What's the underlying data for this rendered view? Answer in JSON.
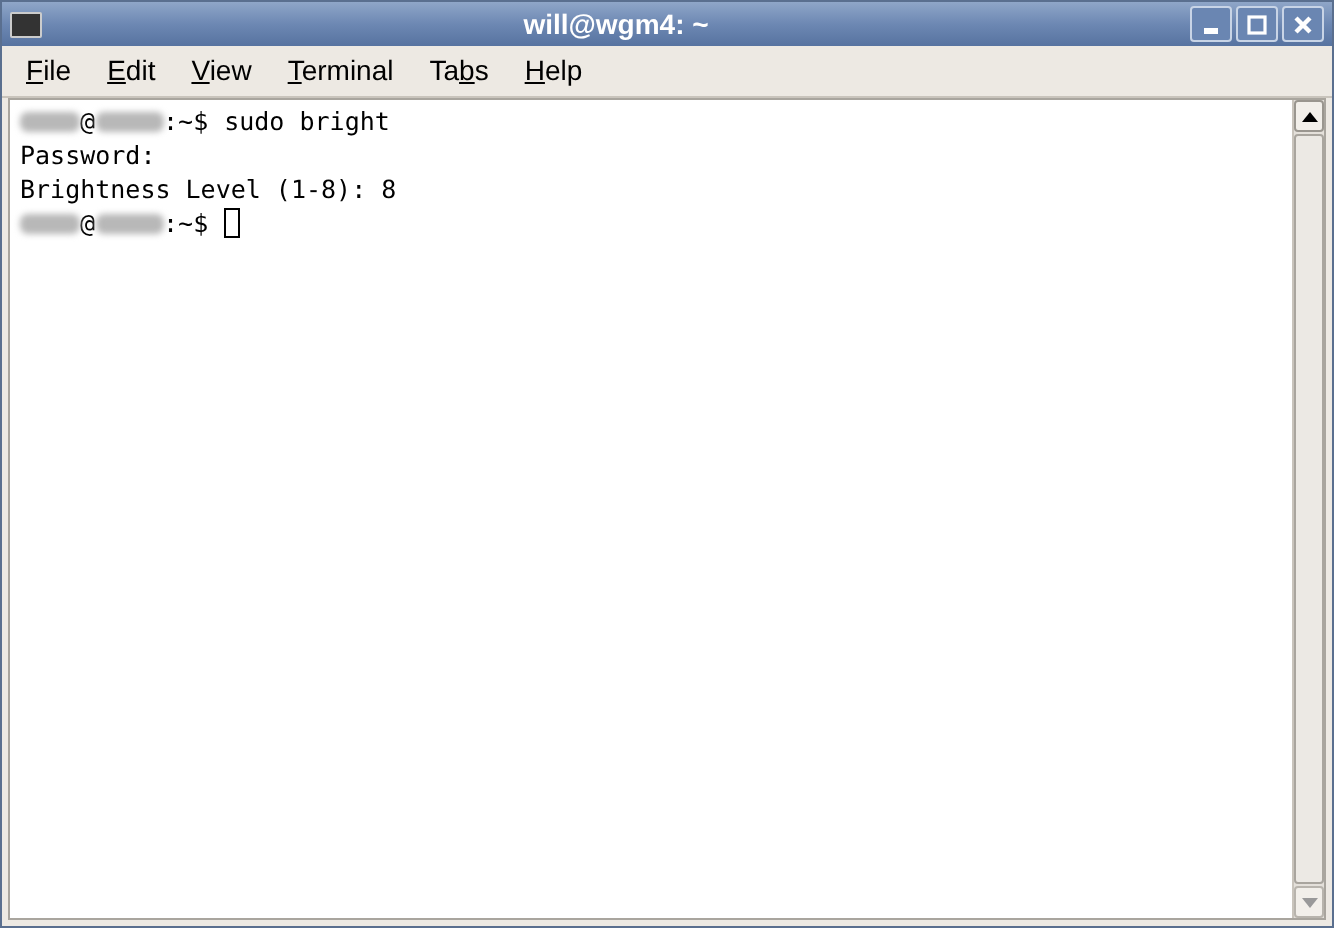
{
  "window": {
    "title": "will@wgm4: ~"
  },
  "menu": [
    {
      "key": "F",
      "after": "ile"
    },
    {
      "key": "E",
      "after": "dit"
    },
    {
      "key": "V",
      "after": "iew"
    },
    {
      "key": "T",
      "after": "erminal"
    },
    {
      "before": "Ta",
      "key": "b",
      "after": "s"
    },
    {
      "key": "H",
      "after": "elp"
    }
  ],
  "terminal": {
    "lines": [
      {
        "kind": "prompt",
        "at": "@",
        "suffix": ":~$",
        "command": "sudo bright"
      },
      {
        "kind": "output",
        "text": "Password:"
      },
      {
        "kind": "output",
        "text": "Brightness Level (1-8): 8"
      },
      {
        "kind": "prompt",
        "at": "@",
        "suffix": ":~$",
        "cursor": true
      }
    ]
  }
}
